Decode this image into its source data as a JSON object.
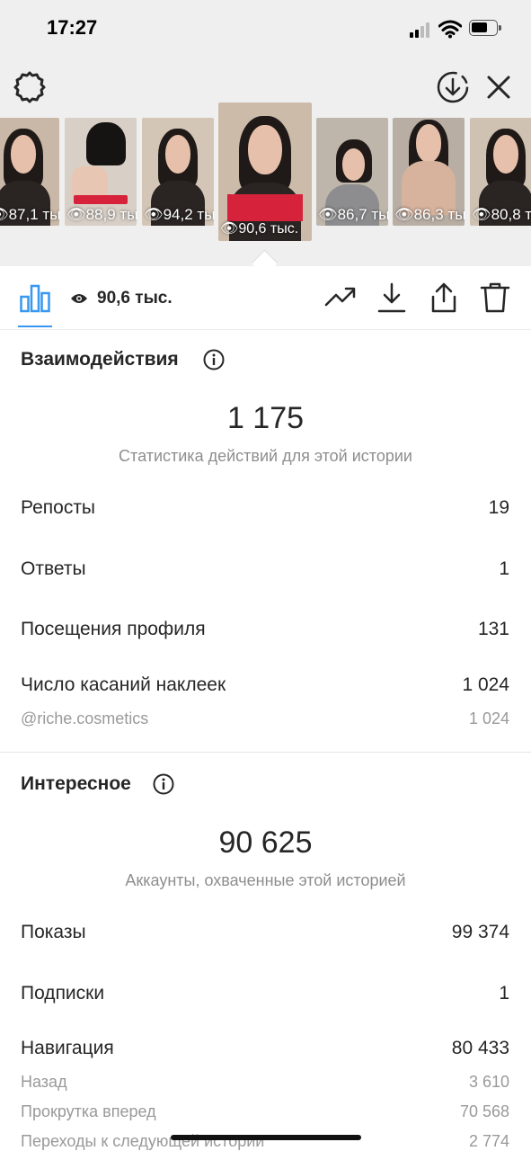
{
  "status_bar": {
    "time": "17:27"
  },
  "stories": [
    {
      "views": "87,1 тыс."
    },
    {
      "views": "88,9 тыс."
    },
    {
      "views": "94,2 тыс."
    },
    {
      "views": "90,6 тыс."
    },
    {
      "views": "86,7 тыс."
    },
    {
      "views": "86,3 тыс."
    },
    {
      "views": "80,8 тыс."
    }
  ],
  "toolbar": {
    "reach": "90,6 тыс."
  },
  "interactions": {
    "title": "Взаимодействия",
    "total": "1 175",
    "caption": "Статистика действий для этой истории",
    "rows": [
      {
        "label": "Репосты",
        "value": "19"
      },
      {
        "label": "Ответы",
        "value": "1"
      },
      {
        "label": "Посещения профиля",
        "value": "131"
      },
      {
        "label": "Число касаний наклеек",
        "value": "1 024"
      }
    ],
    "sticker": {
      "label": "@riche.cosmetics",
      "value": "1 024"
    }
  },
  "discovery": {
    "title": "Интересное",
    "total": "90 625",
    "caption": "Аккаунты, охваченные этой историей",
    "rows": [
      {
        "label": "Показы",
        "value": "99 374"
      },
      {
        "label": "Подписки",
        "value": "1"
      },
      {
        "label": "Навигация",
        "value": "80 433"
      }
    ],
    "navigation": [
      {
        "label": "Назад",
        "value": "3 610"
      },
      {
        "label": "Прокрутка вперед",
        "value": "70 568"
      },
      {
        "label": "Переходы к следующей истории",
        "value": "2 774"
      }
    ]
  }
}
